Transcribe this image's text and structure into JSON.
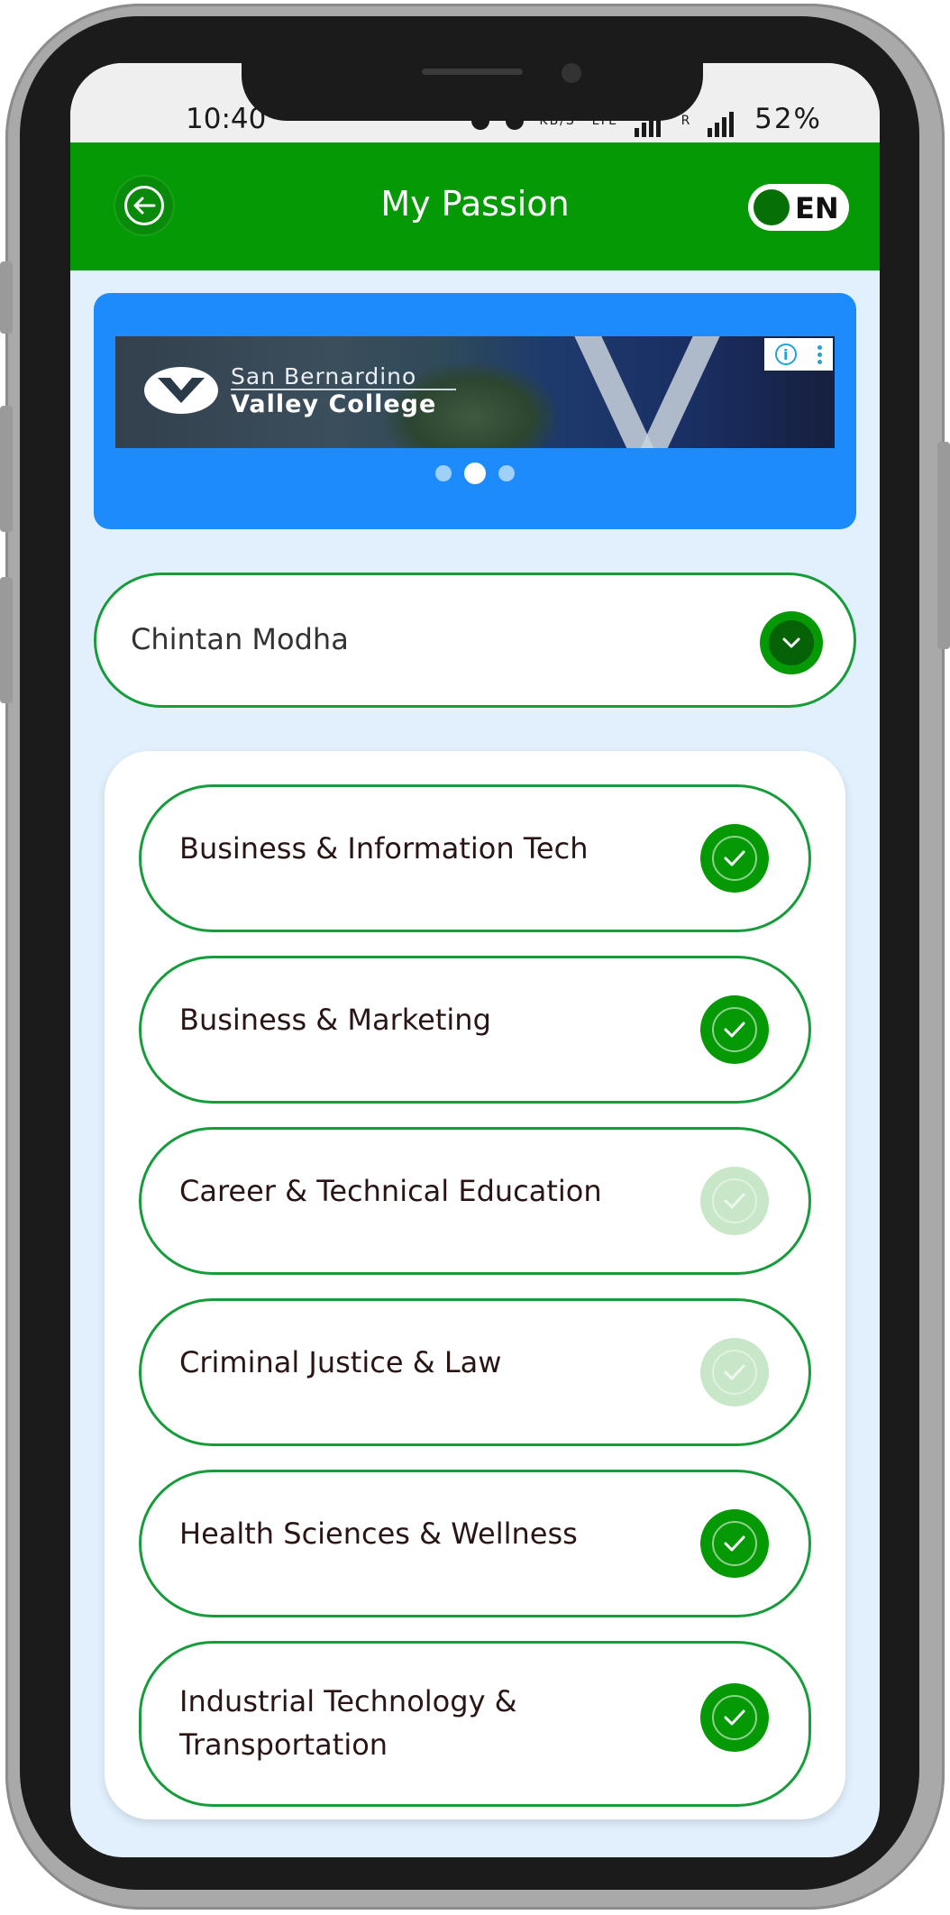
{
  "status_bar": {
    "time": "10:40",
    "net_speed_label": "KB/S",
    "network_label": "LTE",
    "roaming_label": "R",
    "battery": "52%"
  },
  "app_bar": {
    "title": "My Passion",
    "back_icon": "arrow-left-icon",
    "language": "EN",
    "colors": {
      "app_bar": "#059a05",
      "accent": "#169c3a"
    }
  },
  "ad_banner": {
    "line1": "San Bernardino",
    "line2": "Valley College",
    "info_icon": "info-icon",
    "more_icon": "kebab-icon",
    "carousel": {
      "count": 3,
      "active_index": 1
    },
    "background": "#1e8bfd"
  },
  "user_selector": {
    "name": "Chintan Modha",
    "icon": "chevron-down-icon"
  },
  "passions": [
    {
      "label": "Business & Information Tech",
      "selected": true
    },
    {
      "label": "Business & Marketing",
      "selected": true
    },
    {
      "label": "Career & Technical Education",
      "selected": false
    },
    {
      "label": "Criminal Justice & Law",
      "selected": false
    },
    {
      "label": "Health Sciences & Wellness",
      "selected": true
    },
    {
      "label": "Industrial Technology & Transportation",
      "selected": true
    }
  ]
}
